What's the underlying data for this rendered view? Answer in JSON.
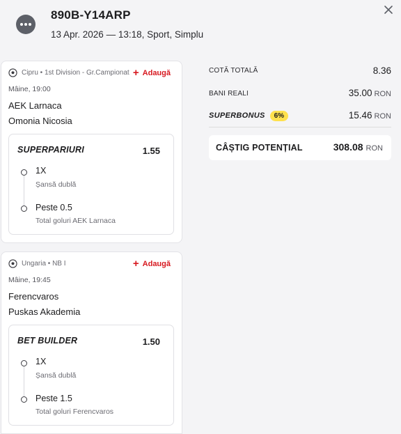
{
  "header": {
    "code": "890B-Y14ARP",
    "meta": "13 Apr. 2026 — 13:18, Sport, Simplu"
  },
  "events": [
    {
      "league": "Cipru • 1st Division - Gr.Campionat",
      "add_label": "Adaugă",
      "time": "Mâine, 19:00",
      "home": "AEK Larnaca",
      "away": "Omonia Nicosia",
      "promo": "SUPERPARIURI",
      "odd": "1.55",
      "selections": [
        {
          "name": "1X",
          "market": "Șansă dublă"
        },
        {
          "name": "Peste 0.5",
          "market": "Total goluri AEK Larnaca"
        }
      ]
    },
    {
      "league": "Ungaria • NB I",
      "add_label": "Adaugă",
      "time": "Mâine, 19:45",
      "home": "Ferencvaros",
      "away": "Puskas Akademia",
      "promo": "BET BUILDER",
      "odd": "1.50",
      "selections": [
        {
          "name": "1X",
          "market": "Șansă dublă"
        },
        {
          "name": "Peste 1.5",
          "market": "Total goluri Ferencvaros"
        }
      ]
    }
  ],
  "summary": {
    "total_odds_label": "COTĂ TOTALĂ",
    "total_odds": "8.36",
    "stake_label": "BANI REALI",
    "stake": "35.00",
    "currency": "RON",
    "superbonus_label": "SUPERBONUS",
    "superbonus_pct": "6%",
    "superbonus_value": "15.46",
    "potential_win_label": "CÂȘTIG POTENȚIAL",
    "potential_win": "308.08"
  },
  "colors": {
    "accent_red": "#d71920",
    "badge_yellow": "#ffe14d",
    "background": "#f4f4f6"
  }
}
